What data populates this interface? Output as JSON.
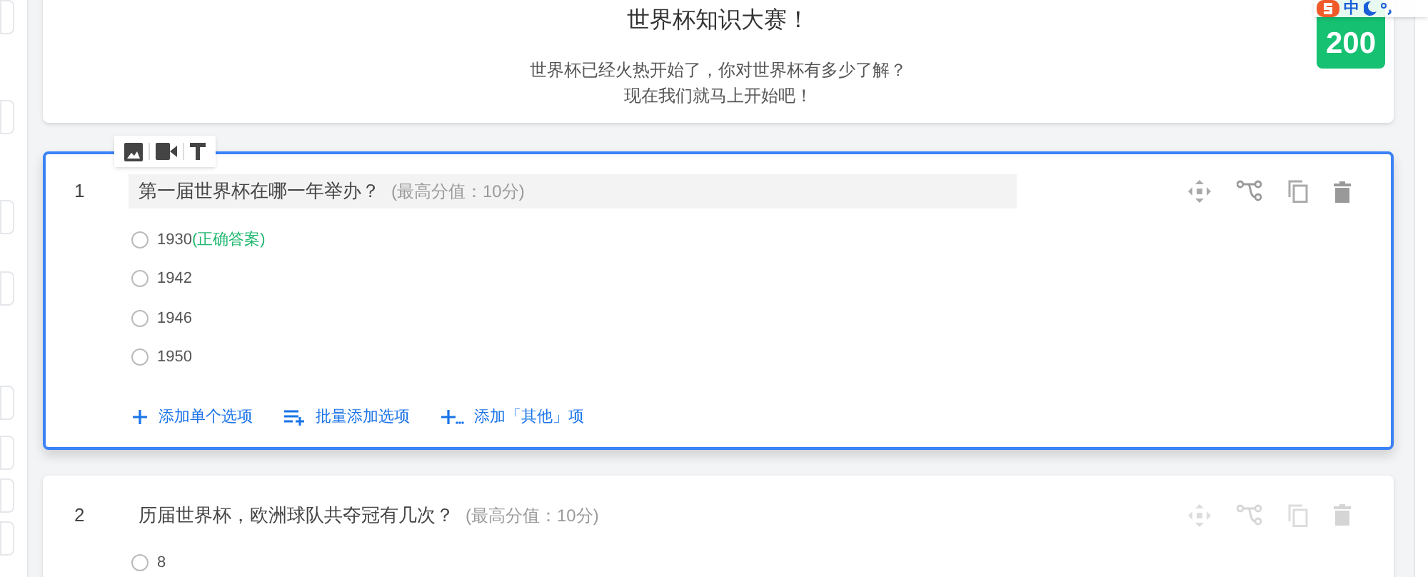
{
  "header": {
    "title": "世界杯知识大赛！",
    "lines": [
      "世界杯已经火热开始了，你对世界杯有多少了解？",
      "现在我们就马上开始吧！"
    ]
  },
  "score_badge": "200",
  "ime_bar": {
    "mode": "中"
  },
  "questions": [
    {
      "number": "1",
      "title": "第一届世界杯在哪一年举办？",
      "max_score": "(最高分值：10分)",
      "selected": true,
      "options": [
        {
          "label": "1930",
          "note": "(正确答案)"
        },
        {
          "label": "1942"
        },
        {
          "label": "1946"
        },
        {
          "label": "1950"
        }
      ],
      "add_actions": [
        {
          "kind": "single",
          "label": "添加单个选项"
        },
        {
          "kind": "batch",
          "label": "批量添加选项"
        },
        {
          "kind": "other",
          "label": "添加「其他」项"
        }
      ]
    },
    {
      "number": "2",
      "title": "历届世界杯，欧洲球队共夺冠有几次？",
      "max_score": "(最高分值：10分)",
      "selected": false,
      "options": [
        {
          "label": "8"
        }
      ]
    }
  ]
}
